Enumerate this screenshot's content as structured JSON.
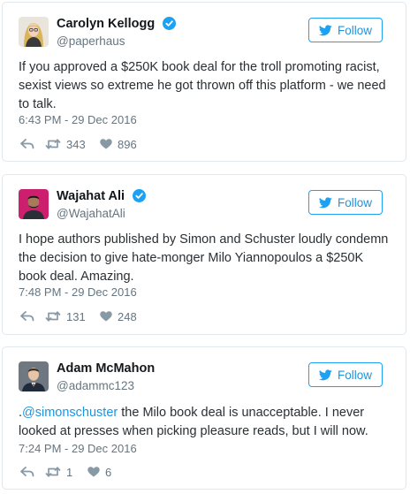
{
  "colors": {
    "link_blue": "#1b95e0",
    "verified_blue": "#1da1f2",
    "muted_gray": "#66757f",
    "border_gray": "#e1e8ed"
  },
  "follow_label": "Follow",
  "tweets": [
    {
      "author": "Carolyn Kellogg",
      "handle": "@paperhaus",
      "verified": true,
      "text": "If you approved a $250K book deal for the troll promoting racist, sexist views so extreme he got thrown off this platform - we need to talk.",
      "timestamp": "6:43 PM - 29 Dec 2016",
      "retweets": "343",
      "likes": "896",
      "icons": [
        "reply-icon",
        "retweet-icon",
        "heart-icon"
      ]
    },
    {
      "author": "Wajahat Ali",
      "handle": "@WajahatAli",
      "verified": true,
      "text": "I hope authors published by Simon and Schuster loudly condemn the decision to give hate-monger Milo Yiannopoulos a $250K book deal. Amazing.",
      "timestamp": "7:48 PM - 29 Dec 2016",
      "retweets": "131",
      "likes": "248",
      "icons": [
        "reply-icon",
        "retweet-icon",
        "heart-icon"
      ]
    },
    {
      "author": "Adam McMahon",
      "handle": "@adammc123",
      "verified": false,
      "text_prefix": ".",
      "text_mention": "@simonschuster",
      "text_rest": " the Milo book deal is unacceptable. I never looked at presses when picking pleasure reads, but I will now.",
      "timestamp": "7:24 PM - 29 Dec 2016",
      "retweets": "1",
      "likes": "6",
      "icons": [
        "reply-icon",
        "retweet-icon",
        "heart-icon"
      ]
    }
  ]
}
